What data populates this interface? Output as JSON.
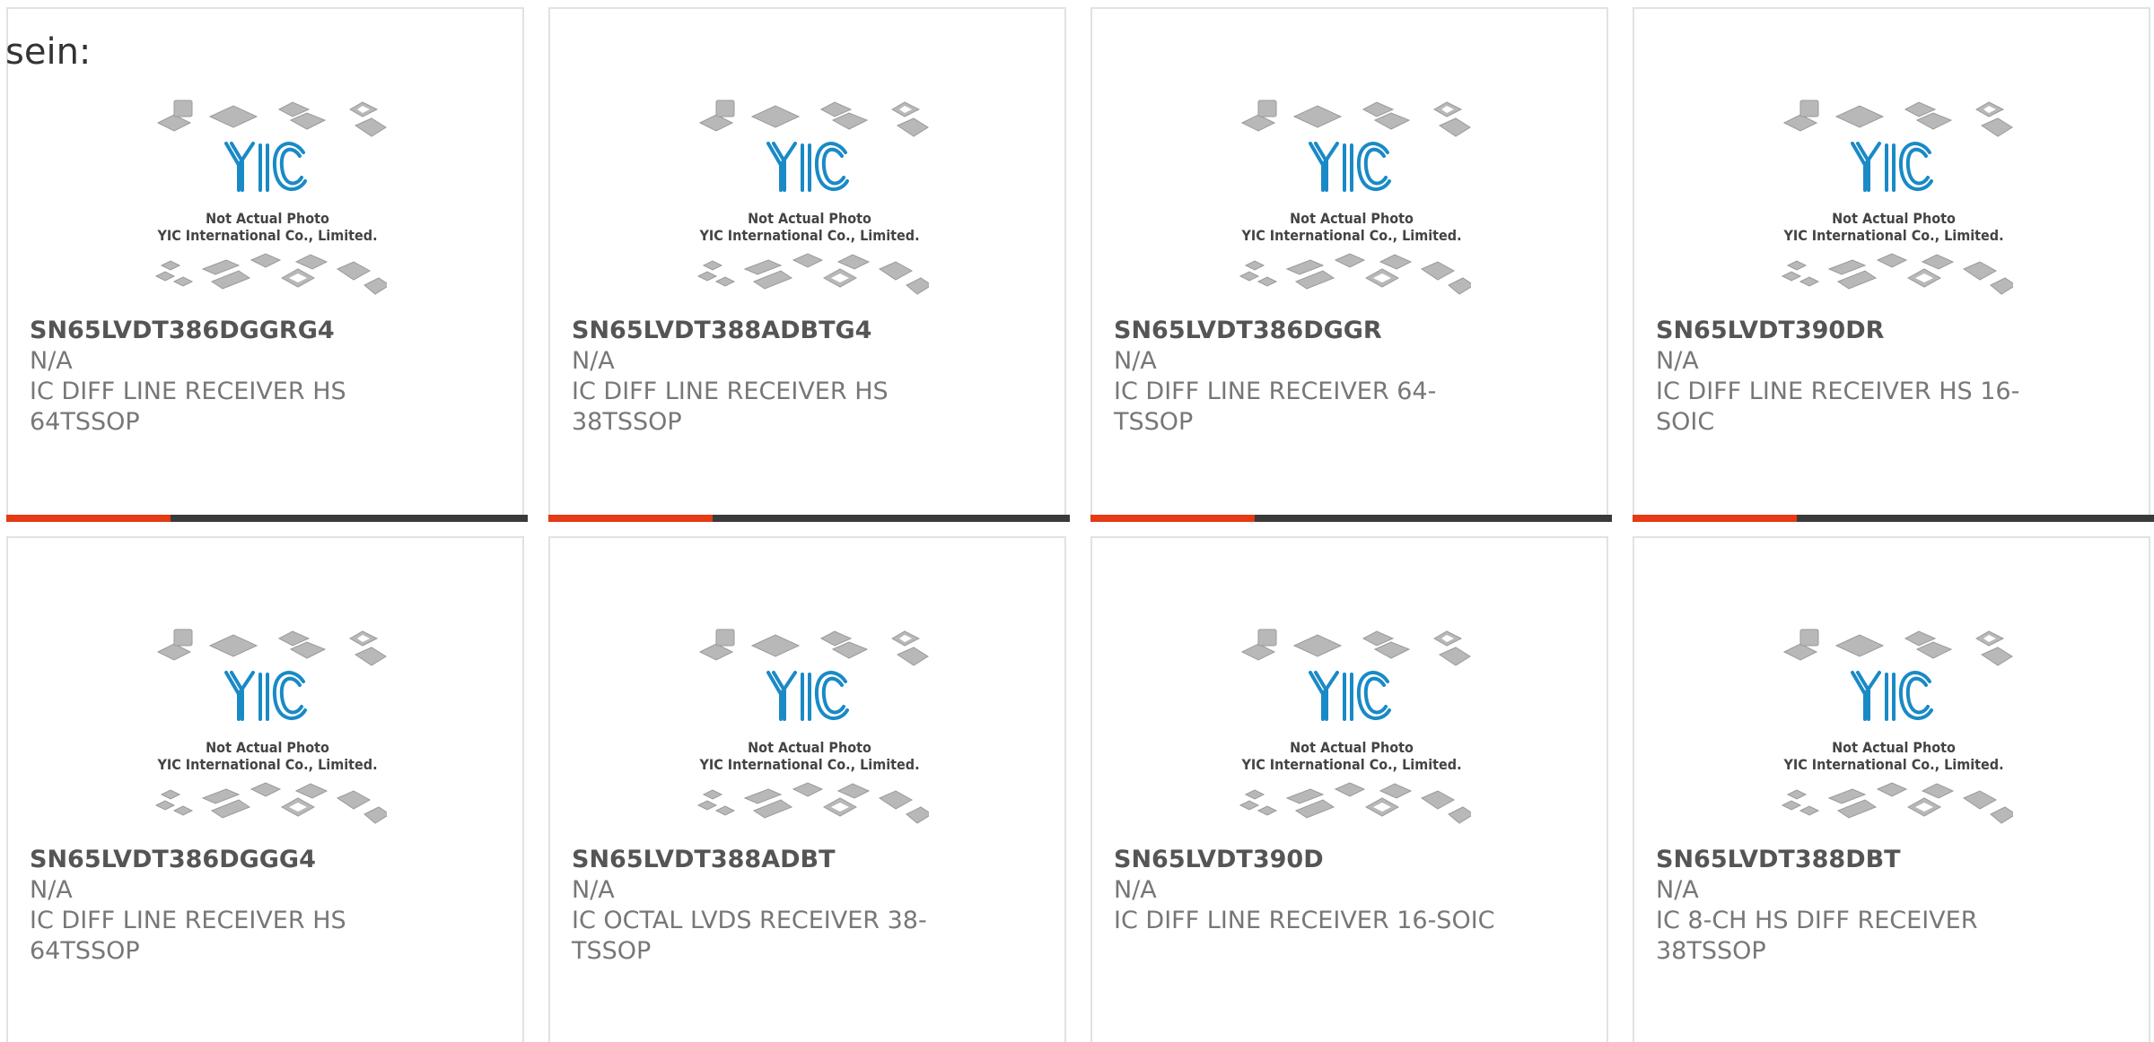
{
  "page": {
    "heading": "sein:",
    "thumbnail": {
      "caption_line1": "Not Actual Photo",
      "caption_line2": "YIC International Co., Limited.",
      "logo_text": "YIC",
      "logo_color": "#1a8ac6"
    },
    "accent_color": "#e53a14",
    "bar_color": "#3a3a3a"
  },
  "products": [
    {
      "part": "SN65LVDT386DGGRG4",
      "mfr": "N/A",
      "desc_line1": "IC DIFF LINE RECEIVER HS",
      "desc_line2": "64TSSOP"
    },
    {
      "part": "SN65LVDT388ADBTG4",
      "mfr": "N/A",
      "desc_line1": "IC DIFF LINE RECEIVER HS",
      "desc_line2": "38TSSOP"
    },
    {
      "part": "SN65LVDT386DGGR",
      "mfr": "N/A",
      "desc_line1": "IC DIFF LINE RECEIVER 64-",
      "desc_line2": "TSSOP"
    },
    {
      "part": "SN65LVDT390DR",
      "mfr": "N/A",
      "desc_line1": "IC DIFF LINE RECEIVER HS 16-",
      "desc_line2": "SOIC"
    },
    {
      "part": "SN65LVDT386DGGG4",
      "mfr": "N/A",
      "desc_line1": "IC DIFF LINE RECEIVER HS",
      "desc_line2": "64TSSOP"
    },
    {
      "part": "SN65LVDT388ADBT",
      "mfr": "N/A",
      "desc_line1": "IC OCTAL LVDS RECEIVER 38-",
      "desc_line2": "TSSOP"
    },
    {
      "part": "SN65LVDT390D",
      "mfr": "N/A",
      "desc_line1": "IC DIFF LINE RECEIVER 16-SOIC",
      "desc_line2": ""
    },
    {
      "part": "SN65LVDT388DBT",
      "mfr": "N/A",
      "desc_line1": "IC 8-CH HS DIFF RECEIVER",
      "desc_line2": "38TSSOP"
    }
  ]
}
